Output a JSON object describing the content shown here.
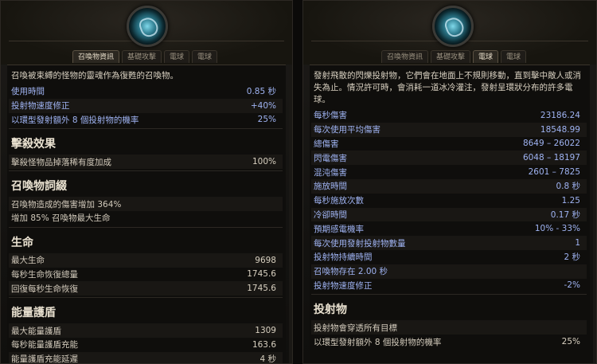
{
  "left": {
    "tabs": [
      "召喚物資訊",
      "基礎攻擊",
      "電球",
      "電球"
    ],
    "active_tab": 0,
    "description": "召喚被束縛的怪物的靈魂作為復甦的召喚物。",
    "stats": [
      {
        "label": "使用時間",
        "value": "0.85 秒",
        "blue": true
      },
      {
        "label": "投射物速度修正",
        "value": "+40%",
        "blue": true
      },
      {
        "label": "以環型發射額外 8 個投射物的機率",
        "value": "25%",
        "blue": true
      }
    ],
    "sections": [
      {
        "title": "擊殺效果",
        "rows": [
          {
            "label": "擊殺怪物品掉落稀有度加成",
            "value": "100%"
          }
        ]
      },
      {
        "title": "召喚物詞綴",
        "rows": [
          {
            "label": "召喚物造成的傷害增加 364%",
            "value": ""
          },
          {
            "label": "增加 85% 召喚物最大生命",
            "value": ""
          }
        ]
      },
      {
        "title": "生命",
        "rows": [
          {
            "label": "最大生命",
            "value": "9698"
          },
          {
            "label": "每秒生命恢復總量",
            "value": "1745.6"
          },
          {
            "label": "回復每秒生命恢復",
            "value": "1745.6"
          }
        ]
      },
      {
        "title": "能量護盾",
        "rows": [
          {
            "label": "最大能量護盾",
            "value": "1309"
          },
          {
            "label": "每秒能量護盾充能",
            "value": "163.6"
          },
          {
            "label": "能量護盾充能延遲",
            "value": "4 秒"
          }
        ]
      }
    ]
  },
  "right": {
    "tabs": [
      "召喚物資訊",
      "基礎攻擊",
      "電球",
      "電球"
    ],
    "active_tab": 2,
    "description": "發射飛散的閃爍投射物，它們會在地面上不規則移動，直到擊中敵人或消失為止。情況許可時，會消耗一道冰冷灌注，發射呈環狀分布的許多電球。",
    "stats": [
      {
        "label": "每秒傷害",
        "value": "23186.24",
        "blue": true
      },
      {
        "label": "每次使用平均傷害",
        "value": "18548.99",
        "blue": true
      },
      {
        "label": "總傷害",
        "value": "8649 – 26022",
        "blue": true
      },
      {
        "label": "閃電傷害",
        "value": "6048 – 18197",
        "blue": true
      },
      {
        "label": "混沌傷害",
        "value": "2601 – 7825",
        "blue": true
      },
      {
        "label": "施放時間",
        "value": "0.8 秒",
        "blue": true
      },
      {
        "label": "每秒施放次數",
        "value": "1.25",
        "blue": true
      },
      {
        "label": "冷卻時間",
        "value": "0.17 秒",
        "blue": true
      },
      {
        "label": "預期感電機率",
        "value": "10% - 33%",
        "blue": true
      },
      {
        "label": "每次使用發射投射物數量",
        "value": "1",
        "blue": true
      },
      {
        "label": "投射物持續時間",
        "value": "2 秒",
        "blue": true
      },
      {
        "label": "召喚物存在 2.00 秒",
        "value": "",
        "blue": true
      },
      {
        "label": "投射物速度修正",
        "value": "-2%",
        "blue": true
      }
    ],
    "sections": [
      {
        "title": "投射物",
        "rows": [
          {
            "label": "投射物會穿透所有目標",
            "value": ""
          },
          {
            "label": "以環型發射額外 8 個投射物的機率",
            "value": "25%"
          }
        ]
      }
    ]
  },
  "colors": {
    "accent_blue": "#9fb3f2",
    "text": "#d2cabb",
    "background": "#0f0e0c"
  }
}
